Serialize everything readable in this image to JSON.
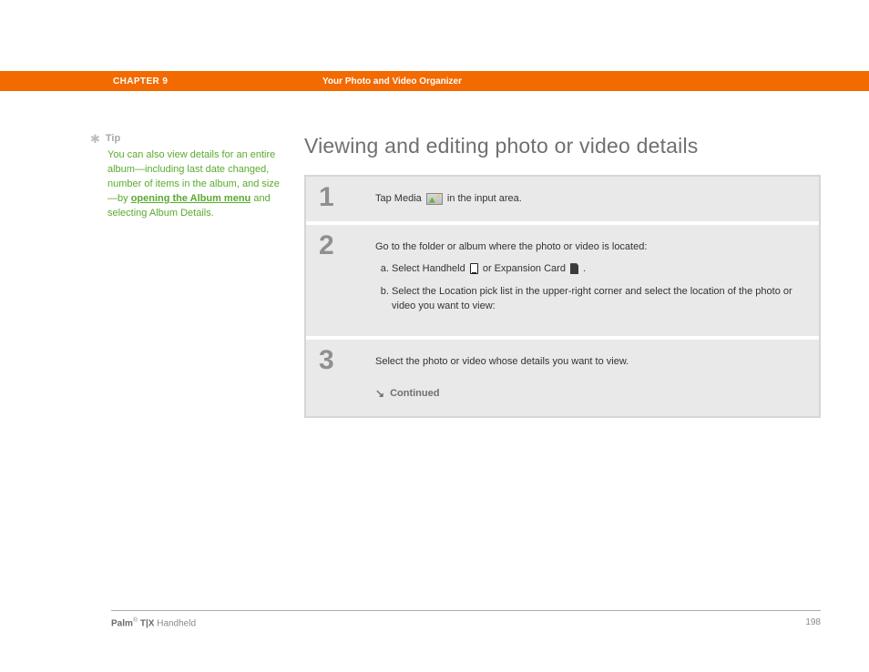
{
  "header": {
    "chapter": "CHAPTER 9",
    "section": "Your Photo and Video Organizer"
  },
  "sidebar": {
    "tip_label": "Tip",
    "tip_pre": "You can also view details for an entire album—including last date changed, number of items in the album, and size—by ",
    "tip_link": "opening the Album menu",
    "tip_post": " and selecting Album Details."
  },
  "main": {
    "title": "Viewing and editing photo or video details"
  },
  "steps": [
    {
      "num": "1",
      "text_pre": "Tap Media ",
      "text_post": " in the input area."
    },
    {
      "num": "2",
      "intro": "Go to the folder or album where the photo or video is located:",
      "a_pre": "Select Handheld ",
      "a_mid": " or Expansion Card ",
      "a_post": ".",
      "b": "Select the Location pick list in the upper-right corner and select the location of the photo or video you want to view:"
    },
    {
      "num": "3",
      "text": "Select the photo or video whose details you want to view.",
      "continued": "Continued"
    }
  ],
  "footer": {
    "brand_strong": "Palm",
    "reg": "®",
    "model_strong": " T|X",
    "model_rest": " Handheld",
    "page": "198"
  }
}
